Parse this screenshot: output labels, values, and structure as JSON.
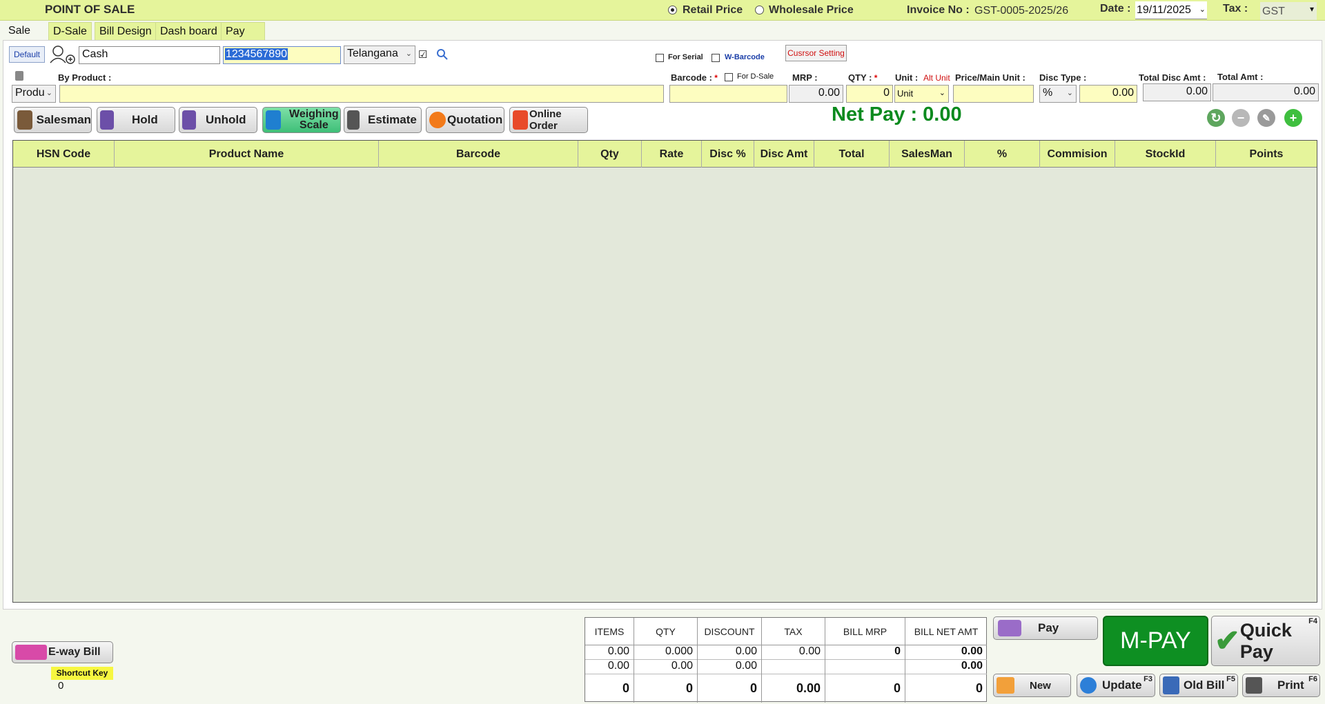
{
  "app": {
    "title": "POINT OF SALE"
  },
  "header": {
    "retail_label": "Retail Price",
    "wholesale_label": "Wholesale Price",
    "invoice_label": "Invoice No :",
    "invoice_value": "GST-0005-2025/26",
    "date_label": "Date :",
    "date_value": "19/11/2025",
    "tax_label": "Tax :",
    "tax_value": "GST"
  },
  "tabs": [
    {
      "label": "Sale"
    },
    {
      "label": "D-Sale"
    },
    {
      "label": "Bill Design"
    },
    {
      "label": "Dash board"
    },
    {
      "label": "Pay"
    }
  ],
  "customer": {
    "default_label": "Default",
    "name": "Cash",
    "phone": "1234567890",
    "state": "Telangana"
  },
  "options": {
    "for_serial": "For Serial",
    "w_barcode": "W-Barcode",
    "cursor_setting": "Cusrsor Setting",
    "for_dsale": "For D-Sale"
  },
  "entry": {
    "by_product_label": "By Product :",
    "product_select": "Produ",
    "barcode_label": "Barcode :",
    "mrp_label": "MRP :",
    "mrp_value": "0.00",
    "qty_label": "QTY :",
    "qty_value": "0",
    "unit_label": "Unit :",
    "alt_unit_label": "Alt Unit",
    "unit_value": "Unit",
    "price_label": "Price/Main Unit :",
    "disc_type_label": "Disc Type :",
    "disc_type_value": "%",
    "disc_value": "0.00",
    "total_disc_label": "Total Disc Amt :",
    "total_disc_value": "0.00",
    "total_amt_label": "Total Amt :",
    "total_amt_value": "0.00"
  },
  "actions": {
    "salesman": "Salesman",
    "hold": "Hold",
    "unhold": "Unhold",
    "weighing_1": "Weighing",
    "weighing_2": "Scale",
    "estimate": "Estimate",
    "quotation": "Quotation",
    "online_order": "Online Order"
  },
  "net_pay": "Net Pay : 0.00",
  "grid": {
    "columns": [
      "HSN Code",
      "Product Name",
      "Barcode",
      "Qty",
      "Rate",
      "Disc %",
      "Disc Amt",
      "Total",
      "SalesMan",
      "%",
      "Commision",
      "StockId",
      "Points"
    ]
  },
  "summary": {
    "headers": [
      "ITEMS",
      "QTY",
      "DISCOUNT",
      "TAX",
      "BILL MRP",
      "BILL NET AMT"
    ],
    "row1": [
      "0.00",
      "0.000",
      "0.00",
      "0.00",
      "0",
      "0.00"
    ],
    "row2": [
      "0.00",
      "0.00",
      "0.00",
      "",
      "",
      "0.00"
    ],
    "totals": [
      "0",
      "0",
      "0",
      "0.00",
      "0",
      "0"
    ]
  },
  "bottom": {
    "eway_bill": "E-way Bill",
    "shortcut_key_label": "Shortcut Key",
    "shortcut_key_value": "0",
    "pay": "Pay",
    "mpay": "M-PAY",
    "quick_pay": "Quick Pay",
    "quick_pay_key": "F4",
    "new": "New",
    "update": "Update",
    "update_key": "F3",
    "old_bill": "Old Bill",
    "old_bill_key": "F5",
    "print": "Print",
    "print_key": "F6"
  },
  "colors": {
    "header_bg": "#e5f49b",
    "net_pay": "#0b8a1e",
    "mpay_bg": "#0e8f22",
    "grid_bg": "#e3e8da"
  }
}
